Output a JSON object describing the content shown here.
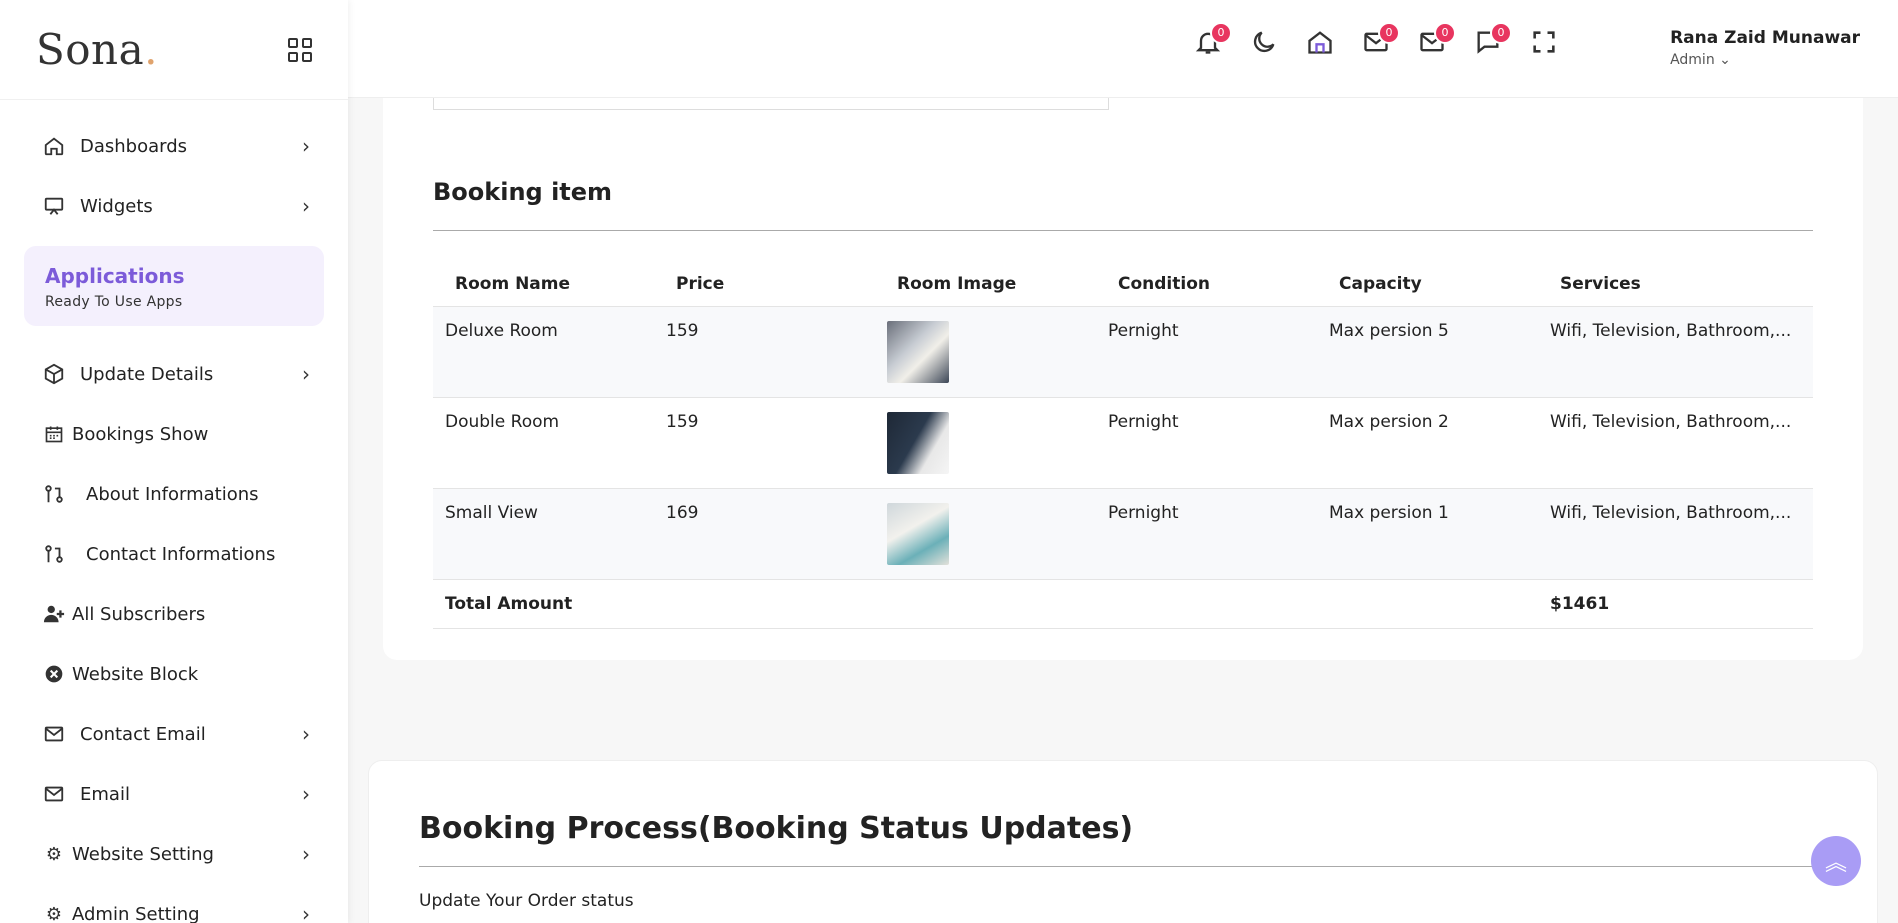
{
  "brand": {
    "name": "Sona",
    "dot": "."
  },
  "sidebar": {
    "items": [
      {
        "label": "Dashboards",
        "icon": "home-icon"
      },
      {
        "label": "Widgets",
        "icon": "monitor-icon"
      },
      {
        "label": "Update Details",
        "icon": "box-icon"
      },
      {
        "label": "Bookings Show",
        "icon": "calendar-icon"
      },
      {
        "label": "About Informations",
        "icon": "git-compare-icon"
      },
      {
        "label": "Contact Informations",
        "icon": "git-compare-icon"
      },
      {
        "label": "All Subscribers",
        "icon": "user-plus-icon"
      },
      {
        "label": "Website Block",
        "icon": "x-circle-icon"
      },
      {
        "label": "Contact Email",
        "icon": "mail-icon"
      },
      {
        "label": "Email",
        "icon": "mail-icon"
      },
      {
        "label": "Website Setting",
        "icon": "gears-icon"
      },
      {
        "label": "Admin Setting",
        "icon": "gears-icon"
      }
    ],
    "apps": {
      "title": "Applications",
      "subtitle": "Ready To Use Apps"
    }
  },
  "header": {
    "badges": {
      "notifications": "0",
      "mail1": "0",
      "mail2": "0",
      "chat": "0"
    },
    "user": {
      "name": "Rana Zaid Munawar",
      "role": "Admin"
    }
  },
  "booking": {
    "title": "Booking item",
    "columns": [
      "Room Name",
      "Price",
      "Room Image",
      "Condition",
      "Capacity",
      "Services"
    ],
    "rows": [
      {
        "name": "Deluxe Room",
        "price": "159",
        "condition": "Pernight",
        "capacity": "Max persion 5",
        "services": "Wifi, Television, Bathroom,..."
      },
      {
        "name": "Double Room",
        "price": "159",
        "condition": "Pernight",
        "capacity": "Max persion 2",
        "services": "Wifi, Television, Bathroom,..."
      },
      {
        "name": "Small View",
        "price": "169",
        "condition": "Pernight",
        "capacity": "Max persion 1",
        "services": "Wifi, Television, Bathroom,..."
      }
    ],
    "total_label": "Total Amount",
    "total_value": "$1461"
  },
  "process": {
    "title": "Booking Process(Booking Status Updates)",
    "subtitle": "Update Your Order status"
  },
  "colors": {
    "accent": "#7c5bd9",
    "badge": "#e8355f",
    "scroll_button": "#a99cf5"
  }
}
